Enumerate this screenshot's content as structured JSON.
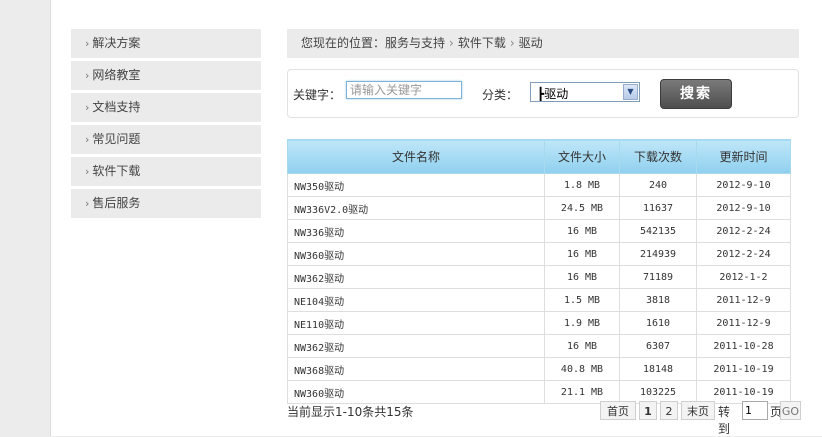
{
  "sidebar": {
    "items": [
      {
        "label": "解决方案"
      },
      {
        "label": "网络教室"
      },
      {
        "label": "文档支持"
      },
      {
        "label": "常见问题"
      },
      {
        "label": "软件下载"
      },
      {
        "label": "售后服务"
      }
    ]
  },
  "breadcrumb": {
    "prefix": "您现在的位置：",
    "items": [
      "服务与支持",
      "软件下载",
      "驱动"
    ]
  },
  "search": {
    "keyword_label": "关键字：",
    "keyword_placeholder": "请输入关键字",
    "category_label": "分类：",
    "category_value": "┣驱动",
    "button_label": "搜索"
  },
  "table": {
    "headers": [
      "文件名称",
      "文件大小",
      "下载次数",
      "更新时间"
    ],
    "rows": [
      [
        "NW350驱动",
        "1.8 MB",
        "240",
        "2012-9-10"
      ],
      [
        "NW336V2.0驱动",
        "24.5 MB",
        "11637",
        "2012-9-10"
      ],
      [
        "NW336驱动",
        "16 MB",
        "542135",
        "2012-2-24"
      ],
      [
        "NW360驱动",
        "16 MB",
        "214939",
        "2012-2-24"
      ],
      [
        "NW362驱动",
        "16 MB",
        "71189",
        "2012-1-2"
      ],
      [
        "NE104驱动",
        "1.5 MB",
        "3818",
        "2011-12-9"
      ],
      [
        "NE110驱动",
        "1.9 MB",
        "1610",
        "2011-12-9"
      ],
      [
        "NW362驱动",
        "16 MB",
        "6307",
        "2011-10-28"
      ],
      [
        "NW368驱动",
        "40.8 MB",
        "18148",
        "2011-10-19"
      ],
      [
        "NW360驱动",
        "21.1 MB",
        "103225",
        "2011-10-19"
      ]
    ]
  },
  "footer": {
    "status": "当前显示1-10条共15条",
    "first": "首页",
    "page1": "1",
    "page2": "2",
    "last": "末页",
    "goto": "转到",
    "goto_value": "1",
    "page_unit": "页",
    "go": "GO"
  }
}
